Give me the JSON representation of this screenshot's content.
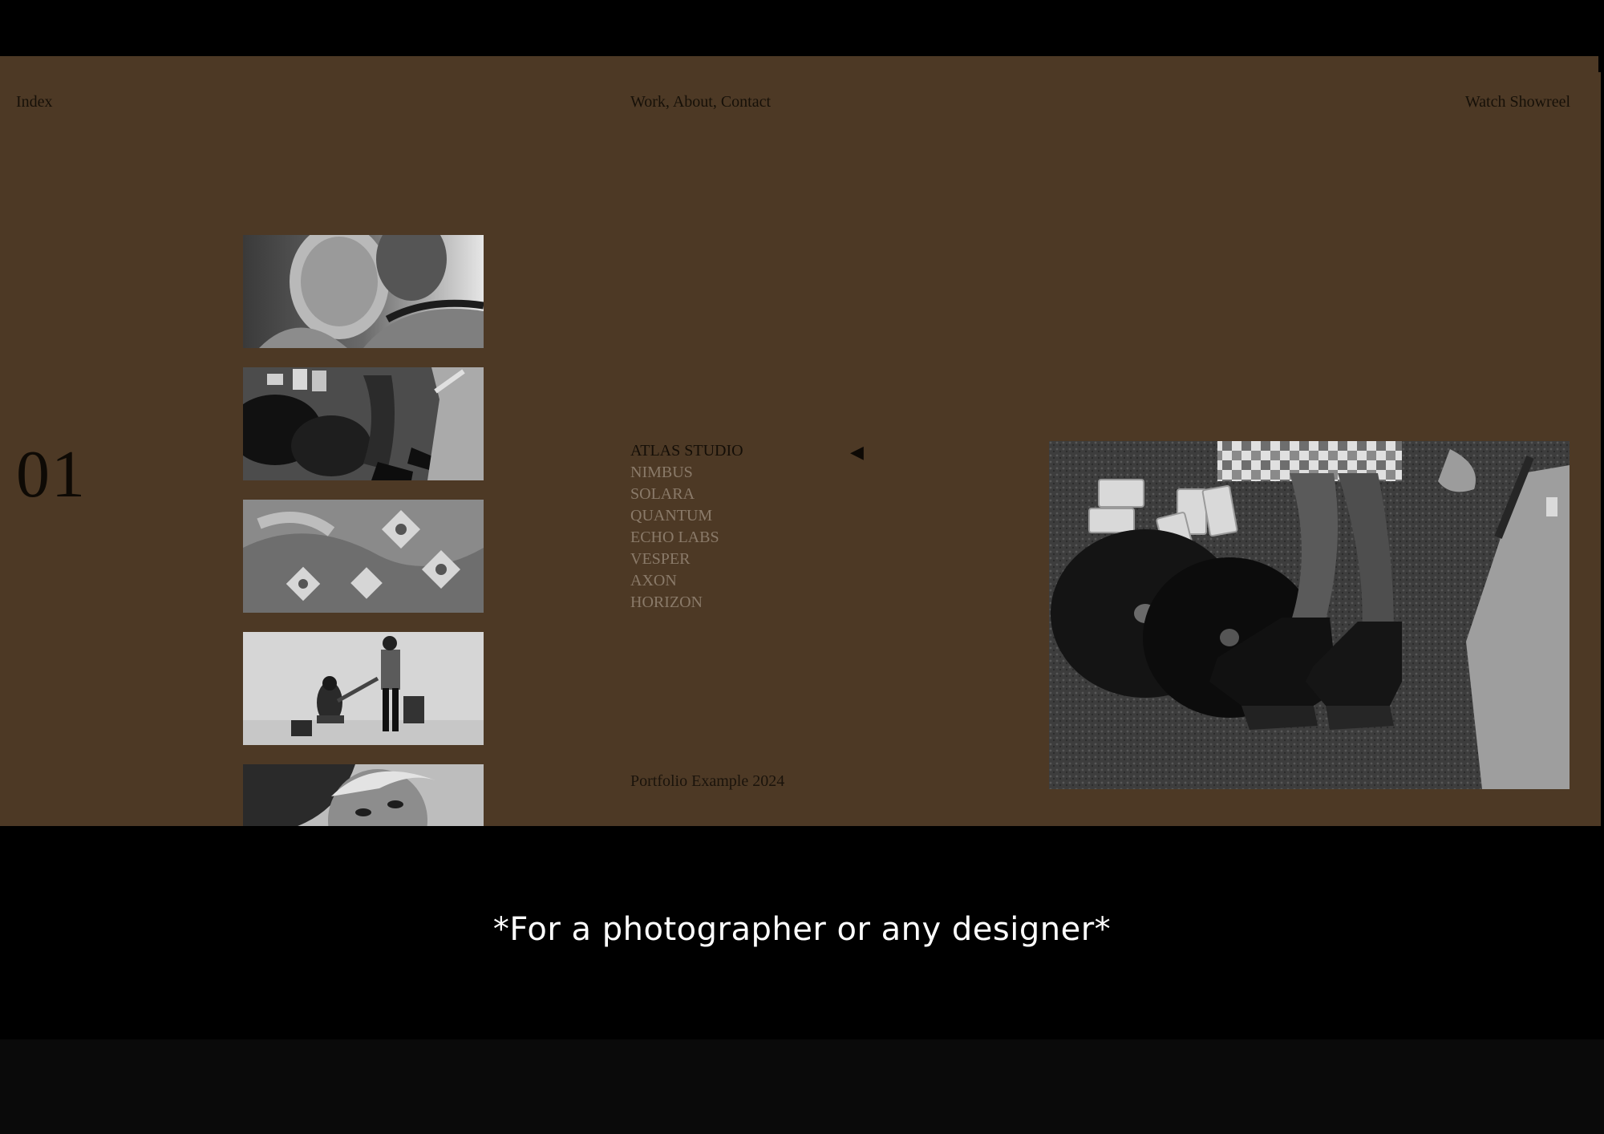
{
  "nav": {
    "index_label": "Index",
    "links_label": "Work, About, Contact",
    "showreel_label": "Watch Showreel"
  },
  "counter": "01",
  "projects": [
    {
      "label": "ATLAS STUDIO",
      "active": true
    },
    {
      "label": "NIMBUS",
      "active": false
    },
    {
      "label": "SOLARA",
      "active": false
    },
    {
      "label": "QUANTUM",
      "active": false
    },
    {
      "label": "ECHO LABS",
      "active": false
    },
    {
      "label": "VESPER",
      "active": false
    },
    {
      "label": "AXON",
      "active": false
    },
    {
      "label": "HORIZON",
      "active": false
    }
  ],
  "active_indicator_icon": "left-triangle-icon",
  "footer": "Portfolio Example 2024",
  "caption": "*For a photographer or any designer*",
  "colors": {
    "page_background": "#4d3925",
    "outer_background": "#000000",
    "active_text": "#140e07",
    "inactive_text": "#8a7a69",
    "caption_text": "#ffffff"
  }
}
